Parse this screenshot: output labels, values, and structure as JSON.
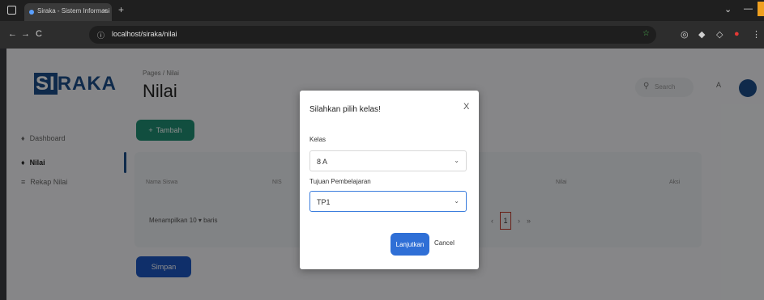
{
  "browser": {
    "tab_title": "Siraka - Sistem Informasi",
    "tab_close": "×",
    "new_tab": "+",
    "url": "localhost/siraka/nilai",
    "back": "←",
    "forward": "→",
    "reload": "C",
    "minimize": "—",
    "dropdown": "⌄"
  },
  "sidebar": {
    "logo_si": "SI",
    "logo_rest": "RAKA",
    "items": [
      {
        "icon": "♦",
        "label": "Dashboard"
      },
      {
        "icon": "♦",
        "label": "Nilai"
      },
      {
        "icon": "≡",
        "label": "Rekap Nilai"
      }
    ]
  },
  "main": {
    "breadcrumb": "Pages / Nilai",
    "title": "Nilai",
    "search_icon": "⚲",
    "search_placeholder": "Search",
    "user_short": "A",
    "add_button": "Tambah",
    "add_icon": "+",
    "table_headers": [
      "Nama Siswa",
      "NIS",
      "Nilai",
      "Aksi"
    ],
    "pager_text": "Menampilkan 10 ▾ baris",
    "pager_prev": "‹",
    "pager_current": "1",
    "pager_next": "›",
    "pager_last": "»",
    "save_button": "Simpan"
  },
  "modal": {
    "title": "Silahkan pilih kelas!",
    "close": "X",
    "kelas_label": "Kelas",
    "kelas_value": "8 A",
    "tujuan_label": "Tujuan Pembelajaran",
    "tujuan_value": "TP1",
    "chevron": "⌄",
    "continue_button": "Lanjutkan",
    "cancel_button": "Cancel"
  },
  "colors": {
    "accent": "#1d4e89",
    "add_button": "#1f8f74",
    "save_button": "#1d57c2",
    "continue_button": "#2f6fd6"
  }
}
